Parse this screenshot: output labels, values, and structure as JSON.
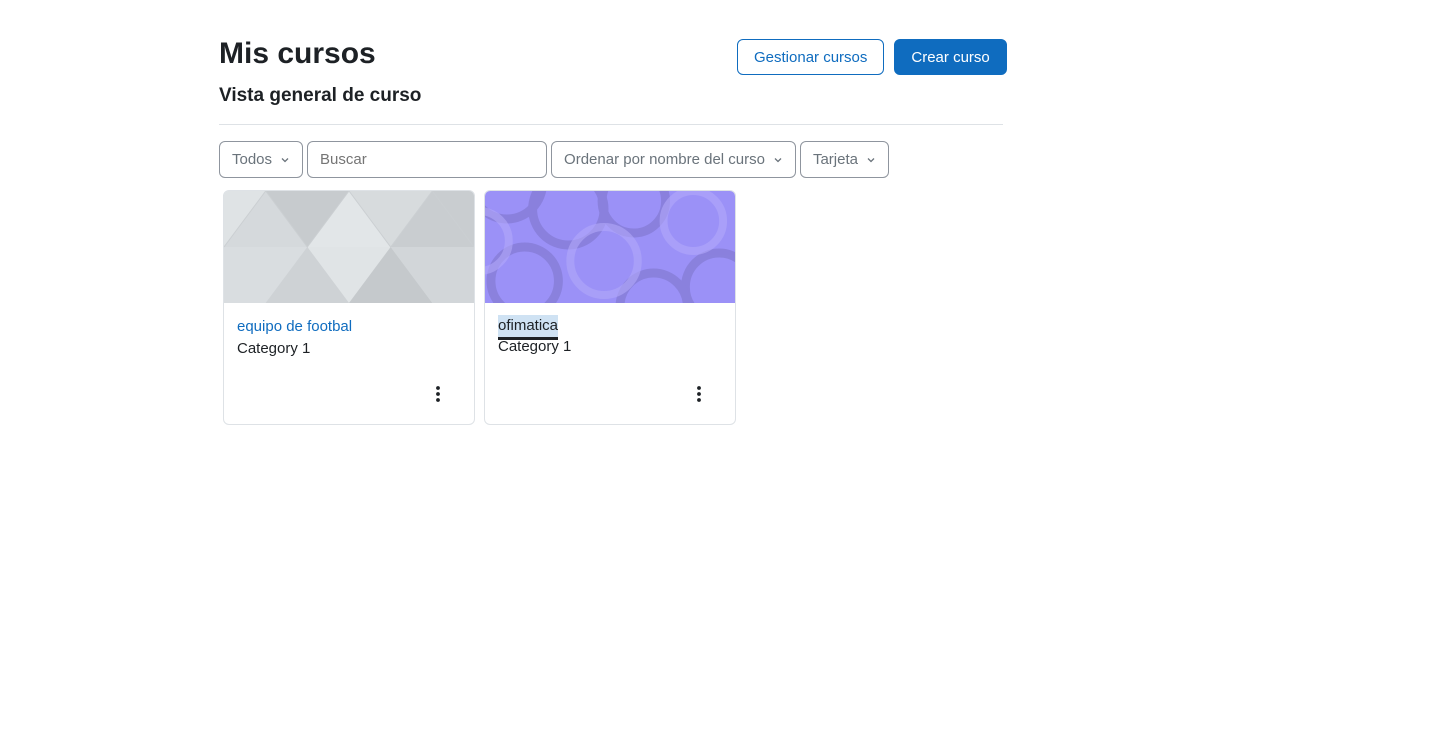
{
  "header": {
    "title": "Mis cursos",
    "manage_label": "Gestionar cursos",
    "create_label": "Crear curso"
  },
  "overview": {
    "title": "Vista general de curso"
  },
  "filters": {
    "grouping": "Todos",
    "search_placeholder": "Buscar",
    "sort": "Ordenar por nombre del curso",
    "view": "Tarjeta"
  },
  "courses": [
    {
      "name": "equipo de footbal",
      "category": "Category 1",
      "pattern": "triangles",
      "color": "#d5d9dc"
    },
    {
      "name": "ofimatica",
      "category": "Category 1",
      "pattern": "circles",
      "color": "#9b91f7"
    }
  ],
  "colors": {
    "primary": "#0f6cbf",
    "text": "#1d2125",
    "border": "#dee2e6"
  }
}
